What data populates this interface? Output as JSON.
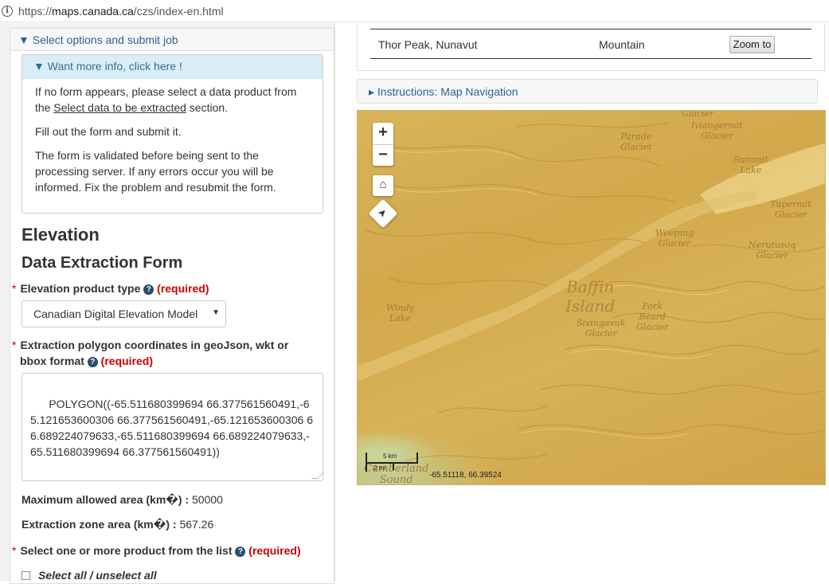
{
  "browser": {
    "url_prefix": "https://",
    "url_host": "maps.canada.ca",
    "url_path": "/czs/index-en.html"
  },
  "left": {
    "options_header": "▼ Select options and submit job",
    "more_info_header": "▼ Want more info, click here !",
    "info_p1_a": "If no form appears, please select a data product from the ",
    "info_p1_link": "Select data to be extracted",
    "info_p1_b": " section.",
    "info_p2": "Fill out the form and submit it.",
    "info_p3": "The form is validated before being sent to the processing server. If any errors occur you will be informed. Fix the problem and resubmit the form.",
    "heading_elevation": "Elevation",
    "heading_form": "Data Extraction Form",
    "required_star": "*",
    "required_text": "(required)",
    "product_type_label": "Elevation product type",
    "product_type_value": "Canadian Digital Elevation Model",
    "polygon_label_line1": "Extraction polygon coordinates in geoJson, wkt or",
    "polygon_label_line2": "bbox format",
    "polygon_value": "POLYGON((-65.511680399694 66.377561560491,-65.121653600306 66.377561560491,-65.121653600306 66.689224079633,-65.511680399694 66.689224079633,-65.511680399694 66.377561560491))",
    "max_area_label": "Maximum allowed area (km\u0000) :",
    "max_area_value": "50000",
    "zone_area_label": "Extraction zone area (km\u0000) :",
    "zone_area_value": "567.26",
    "product_list_label": "Select one or more product from the list",
    "select_all_label": "Select all / unselect all"
  },
  "right": {
    "result_name": "Thor Peak, Nunavut",
    "result_type": "Mountain",
    "zoom_button": "Zoom to",
    "instructions_header": "▸ Instructions: Map Navigation"
  },
  "map": {
    "zoom_in": "+",
    "zoom_out": "−",
    "home_icon": "⌂",
    "locate_icon": "➤",
    "places": {
      "glacier_top": "Glacier",
      "iviangernat": "Iviangernat\nGlacier",
      "parade": "Parade\nGlaciet",
      "summit_lake": "Summit\nLake",
      "tupermit": "Tupermit\nGlacier",
      "weeping": "Weeping\nGlacier",
      "nerutusoq": "Nerutusoq\nGlacier",
      "baffin": "Baffin\nIsland",
      "windy_lake": "Windy\nLake",
      "fork_beard": "Fork\nBeard\nGlacier",
      "sivingavuk": "Sivingavuk\nGlacier",
      "sound": "Cumberland\nSound"
    },
    "scale_km": "5 km",
    "scale_mi": "2 mi",
    "coordinates": "-65.51118, 66.39524",
    "colors": {
      "terrain": "#d4ab4c",
      "water": "#f0d890",
      "lowland": "#c8d8a0"
    }
  }
}
